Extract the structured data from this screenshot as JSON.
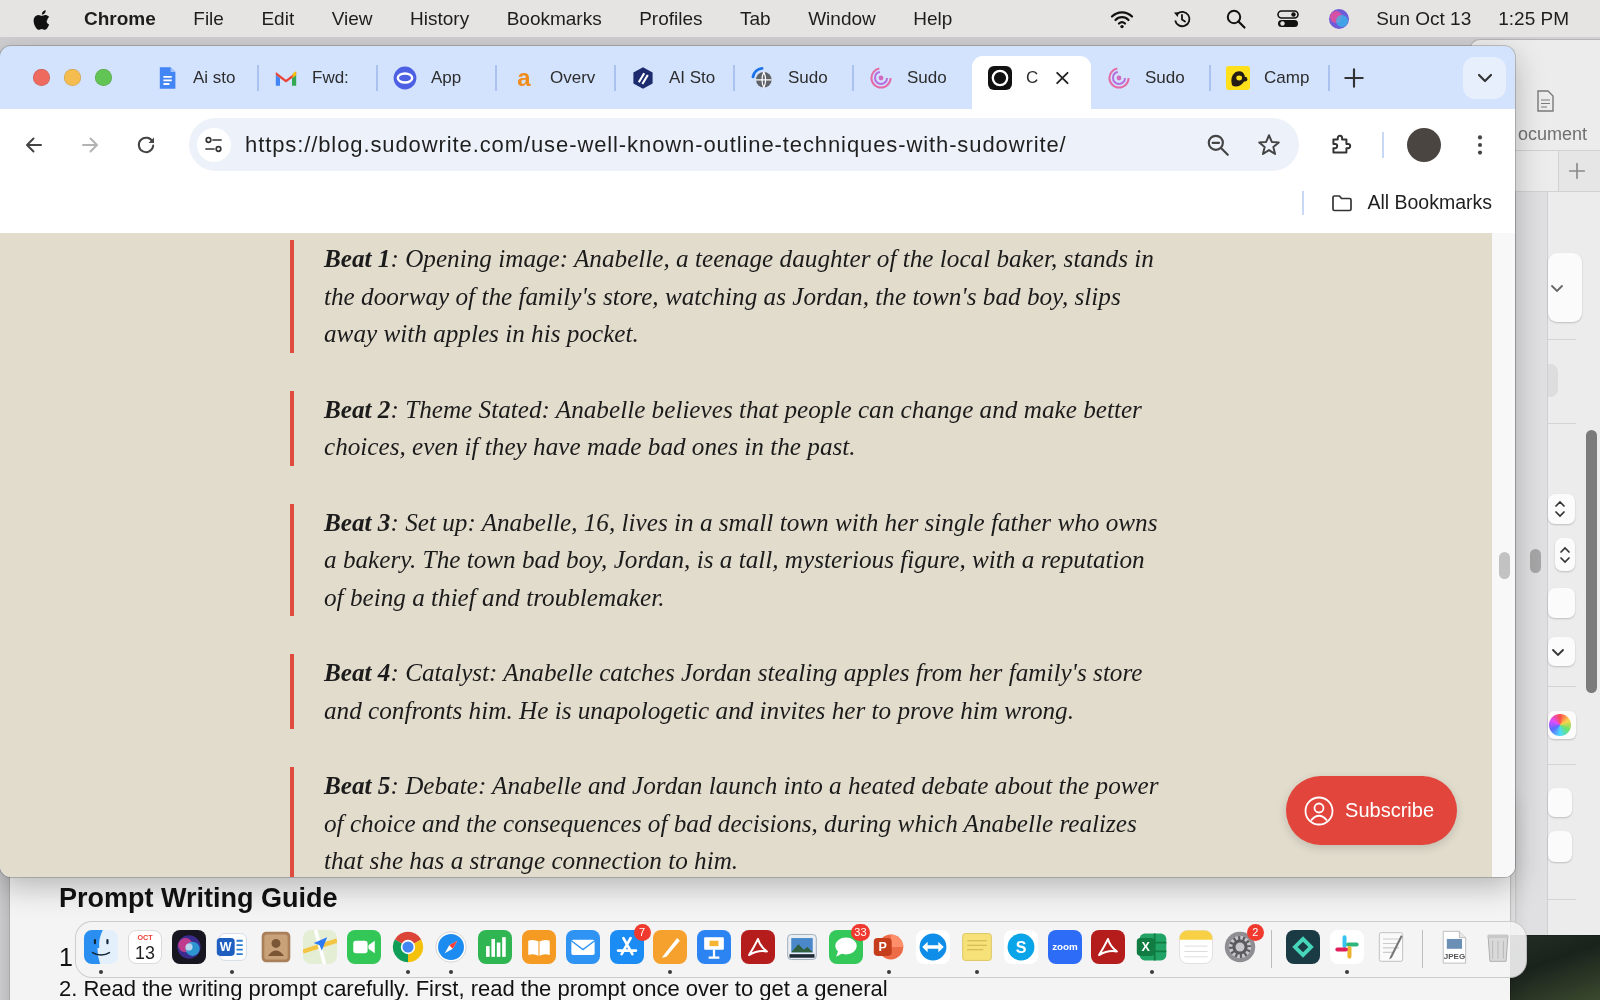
{
  "menu_bar": {
    "app_name": "Chrome",
    "items": [
      "File",
      "Edit",
      "View",
      "History",
      "Bookmarks",
      "Profiles",
      "Tab",
      "Window",
      "Help"
    ],
    "date": "Sun Oct 13",
    "time": "1:25 PM"
  },
  "browser": {
    "tabs": [
      {
        "kind": "docs",
        "title": "Ai sto",
        "selected": false
      },
      {
        "kind": "gmail",
        "title": "Fwd:",
        "selected": false
      },
      {
        "kind": "circle_wave",
        "title": "App",
        "selected": false
      },
      {
        "kind": "letter",
        "glyph": "a",
        "title": "Overv",
        "selected": false
      },
      {
        "kind": "hexagon",
        "title": "AI Sto",
        "selected": false
      },
      {
        "kind": "globe",
        "title": "Sudo",
        "selected": false
      },
      {
        "kind": "spiral",
        "title": "Sudo",
        "selected": false
      },
      {
        "kind": "ring",
        "title": "C",
        "selected": true
      },
      {
        "kind": "spiral",
        "title": "Sudo",
        "selected": false
      },
      {
        "kind": "mascot",
        "title": "Camp",
        "selected": false
      }
    ],
    "nav_buttons": [
      {
        "kind": "back",
        "disabled": false
      },
      {
        "kind": "forward",
        "disabled": true
      },
      {
        "kind": "reload",
        "disabled": false
      }
    ],
    "address_bar": {
      "value": "https://blog.sudowrite.com/use-well-known-outline-techniques-with-sudowrite/"
    },
    "bookmarks_bar": {
      "folder_label": "All Bookmarks"
    },
    "article": {
      "beats": [
        {
          "text": "**Beat 1**: Opening image: Anabelle, a teenage daughter of the local baker, stands in the doorway of the family's store, watching as Jordan, the town's bad boy, slips away with apples in his pocket."
        },
        {
          "text": "**Beat 2**: Theme Stated: Anabelle believes that people can change and make better choices, even if they have made bad ones in the past."
        },
        {
          "text": "**Beat 3**: Set up: Anabelle, 16, lives in a small town with her single father who owns a bakery. The town bad boy, Jordan, is a tall, mysterious figure, with a reputation of being a thief and troublemaker."
        },
        {
          "text": "**Beat 4**: Catalyst: Anabelle catches Jordan stealing apples from her family's store and confronts him. He is unapologetic and invites her to prove him wrong."
        },
        {
          "text": "**Beat 5**: Debate: Anabelle and Jordan launch into a heated debate about the power of choice and the consequences of bad decisions, during which Anabelle realizes that she has a strange connection to him."
        }
      ]
    },
    "subscribe_button": {
      "label": "Subscribe"
    }
  },
  "background_window": {
    "button_label": "ocument"
  },
  "document_window": {
    "heading": "Prompt Writing Guide",
    "list_items": [
      "1",
      "2. Read the writing prompt carefully. First, read the prompt once over to get a general"
    ]
  },
  "dock": {
    "sections": [
      {
        "items": [
          {
            "kind": "finder",
            "running": true
          },
          {
            "kind": "calendar",
            "month": "OCT",
            "day": "13",
            "running": false
          },
          {
            "kind": "siri",
            "running": false
          },
          {
            "kind": "word",
            "glyph": "W",
            "running": true
          },
          {
            "kind": "contacts",
            "running": false
          },
          {
            "kind": "maps",
            "running": false
          },
          {
            "kind": "facetime",
            "running": false
          },
          {
            "kind": "chrome",
            "running": true
          },
          {
            "kind": "safari",
            "running": true
          },
          {
            "kind": "numbers",
            "running": false
          },
          {
            "kind": "books",
            "running": false
          },
          {
            "kind": "mail",
            "running": false
          },
          {
            "kind": "appstore",
            "badge": "7",
            "running": false
          },
          {
            "kind": "pages",
            "running": true
          },
          {
            "kind": "keynote",
            "running": false
          },
          {
            "kind": "acrobat",
            "running": false
          },
          {
            "kind": "preview",
            "running": false
          },
          {
            "kind": "messages",
            "badge": "33",
            "running": false
          },
          {
            "kind": "powerpoint",
            "glyph": "P",
            "running": true
          },
          {
            "kind": "teamviewer",
            "running": false
          },
          {
            "kind": "stickies",
            "running": true
          },
          {
            "kind": "skype",
            "glyph": "S",
            "running": false
          },
          {
            "kind": "zoom",
            "glyph": "zoom",
            "running": false
          },
          {
            "kind": "acrobat",
            "running": false
          },
          {
            "kind": "excel",
            "glyph": "X",
            "running": true
          },
          {
            "kind": "notes",
            "running": false
          },
          {
            "kind": "settings",
            "badge": "2",
            "running": false
          }
        ]
      },
      {
        "items": [
          {
            "kind": "filmora",
            "running": false
          },
          {
            "kind": "slack",
            "running": true
          },
          {
            "kind": "textedit",
            "running": false
          }
        ]
      },
      {
        "items": [
          {
            "kind": "file",
            "glyph": "JPEG",
            "running": false
          },
          {
            "kind": "trash",
            "running": false
          }
        ]
      }
    ]
  }
}
